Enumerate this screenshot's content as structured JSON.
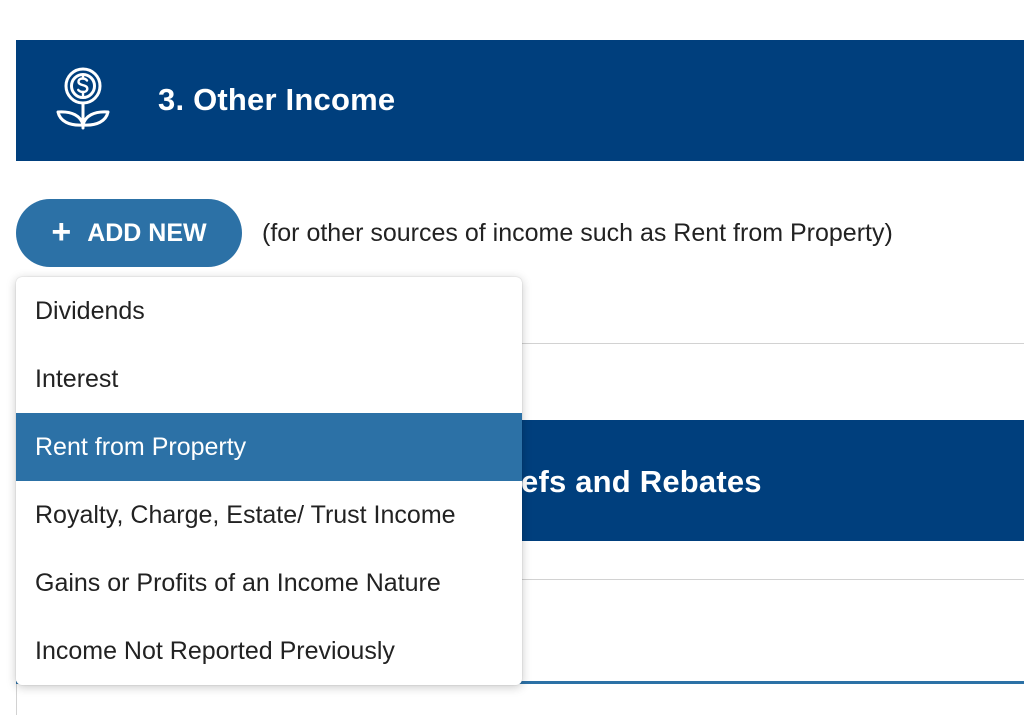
{
  "colors": {
    "header_bg": "#003f7d",
    "accent": "#2c71a6",
    "text": "#222222"
  },
  "section_income": {
    "icon": "money-plant-icon",
    "title": "3. Other Income"
  },
  "add_new": {
    "plus_icon": "+",
    "label": "ADD NEW",
    "hint": "(for other sources of income such as Rent from Property)"
  },
  "dropdown": {
    "selected_index": 2,
    "items": [
      {
        "label": "Dividends"
      },
      {
        "label": "Interest"
      },
      {
        "label": "Rent from Property"
      },
      {
        "label": "Royalty, Charge, Estate/ Trust Income"
      },
      {
        "label": "Gains or Profits of an Income Nature"
      },
      {
        "label": "Income Not Reported Previously"
      }
    ]
  },
  "section_reliefs": {
    "title_visible": "efs and Rebates"
  }
}
